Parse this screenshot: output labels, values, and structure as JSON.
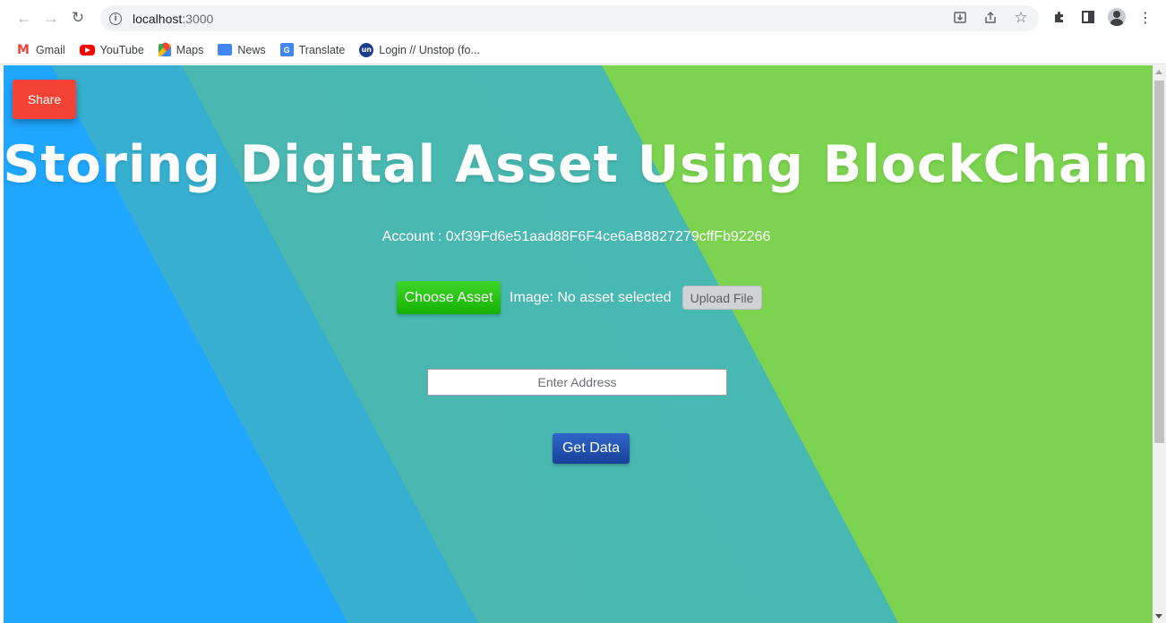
{
  "browser": {
    "url_host": "localhost",
    "url_port": ":3000",
    "bookmarks": [
      {
        "label": "Gmail",
        "icon": "gmail-icon"
      },
      {
        "label": "YouTube",
        "icon": "youtube-icon"
      },
      {
        "label": "Maps",
        "icon": "maps-icon"
      },
      {
        "label": "News",
        "icon": "news-icon"
      },
      {
        "label": "Translate",
        "icon": "translate-icon"
      },
      {
        "label": "Login // Unstop (fo...",
        "icon": "unstop-icon"
      }
    ],
    "icons": {
      "back": "back-arrow-icon",
      "forward": "forward-arrow-icon",
      "reload": "reload-icon",
      "site_info": "info-icon",
      "install": "install-icon",
      "share": "share-icon",
      "bookmark": "star-icon",
      "extensions": "puzzle-icon",
      "side_panel": "side-panel-icon",
      "profile": "profile-icon",
      "menu": "kebab-menu-icon"
    }
  },
  "app": {
    "share_label": "Share",
    "title": "Storing Digital Asset Using BlockChain",
    "account_text": "Account : 0xf39Fd6e51aad88F6F4ce6aB8827279cffFb92266",
    "choose_asset_label": "Choose Asset",
    "image_status": "Image: No asset selected",
    "upload_label": "Upload File",
    "address_placeholder": "Enter Address",
    "get_data_label": "Get Data"
  },
  "colors": {
    "share_button": "#f44336",
    "choose_button": "#16b000",
    "get_data_button": "#17409a",
    "background_blue": "#1fa6ff",
    "background_teal": "#48b8b2",
    "background_green": "#7bd34f"
  }
}
